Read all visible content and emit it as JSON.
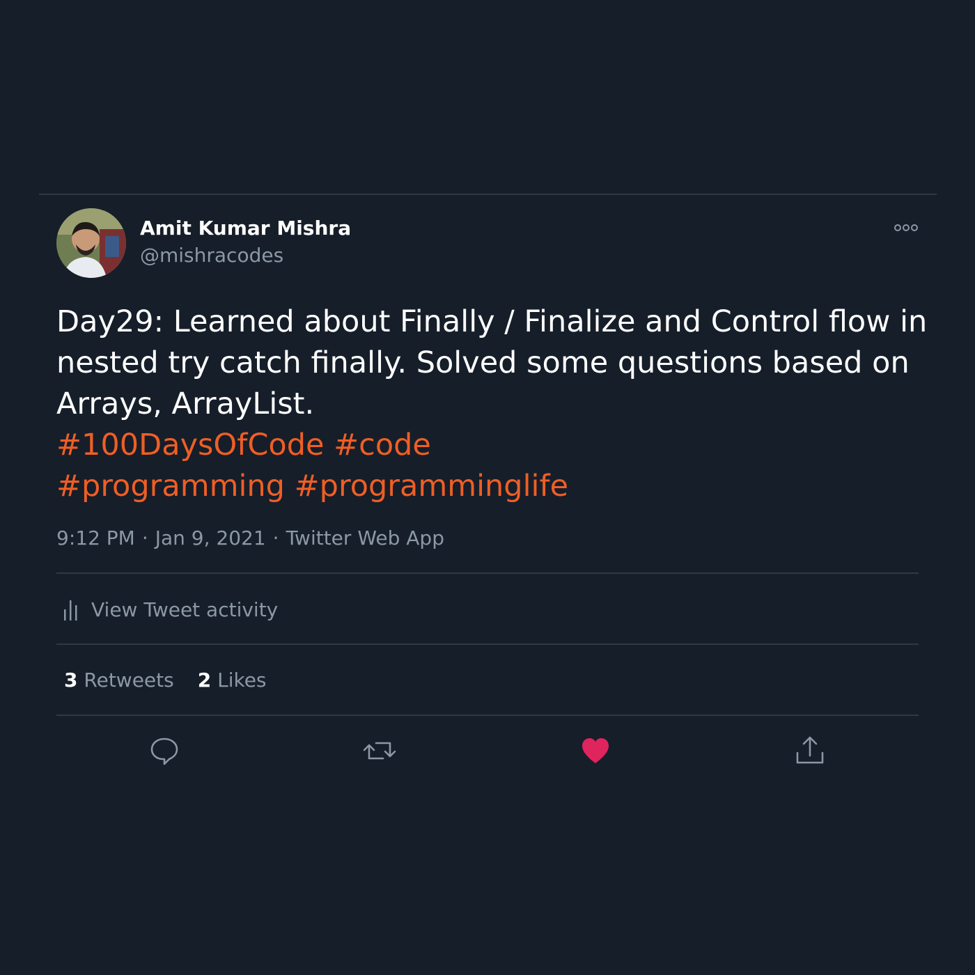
{
  "author": {
    "display_name": "Amit Kumar Mishra",
    "handle": "@mishracodes"
  },
  "tweet": {
    "lines": [
      "Day29: Learned about Finally / Finalize and Control flow in",
      "nested try catch finally. Solved some questions based on",
      "Arrays, ArrayList."
    ],
    "hashtags": [
      [
        "#100DaysOfCode",
        "#code"
      ],
      [
        "#programming",
        "#programminglife"
      ]
    ]
  },
  "meta": {
    "time": "9:12 PM",
    "date": "Jan 9, 2021",
    "separator": "·",
    "source": "Twitter Web App"
  },
  "activity": {
    "label": "View Tweet activity"
  },
  "stats": {
    "retweets_count": "3",
    "retweets_label": "Retweets",
    "likes_count": "2",
    "likes_label": "Likes"
  },
  "actions": {
    "reply_icon": "reply-icon",
    "retweet_icon": "retweet-icon",
    "like_icon": "heart-icon",
    "like_active": true,
    "share_icon": "share-icon"
  },
  "colors": {
    "background": "#161e29",
    "text_primary": "#ffffff",
    "text_secondary": "#8b98a5",
    "hashtag": "#ef5e25",
    "like_active": "#e0245e",
    "divider": "#2f3944"
  }
}
